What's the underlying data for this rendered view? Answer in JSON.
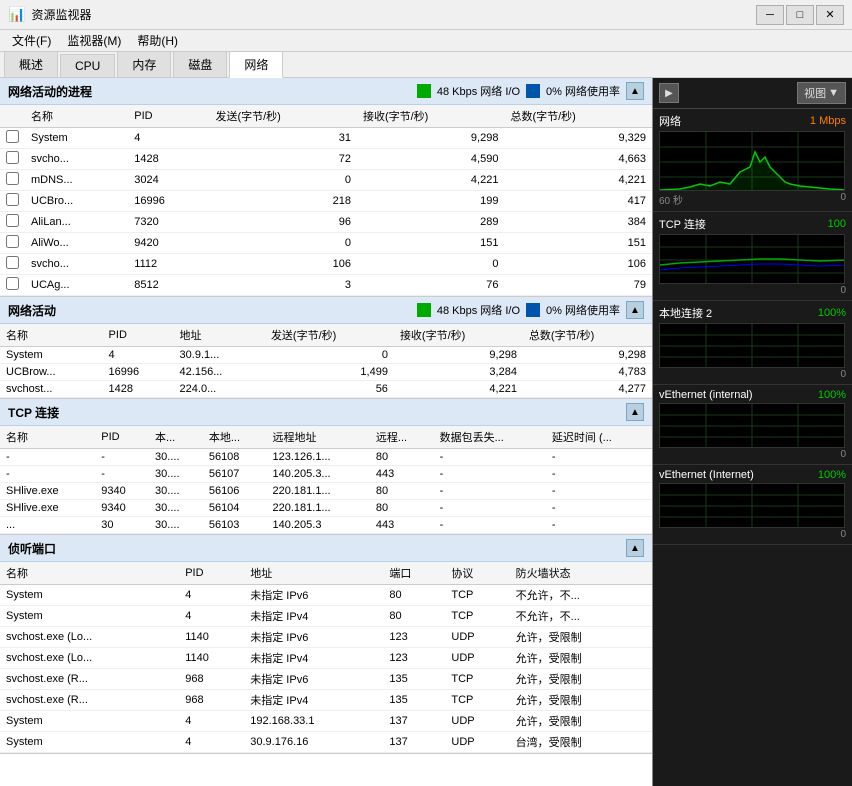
{
  "window": {
    "title": "资源监视器",
    "icon": "📊"
  },
  "titlebar": {
    "minimize": "─",
    "maximize": "□",
    "close": "✕"
  },
  "menubar": {
    "items": [
      "文件(F)",
      "监视器(M)",
      "帮助(H)"
    ]
  },
  "tabs": {
    "items": [
      "概述",
      "CPU",
      "内存",
      "磁盘",
      "网络"
    ],
    "active": "网络"
  },
  "sections": {
    "network_processes": {
      "title": "网络活动的进程",
      "status": "48 Kbps 网络 I/O",
      "status2": "0% 网络使用率",
      "columns": [
        "名称",
        "PID",
        "发送(字节/秒)",
        "接收(字节/秒)",
        "总数(字节/秒)"
      ],
      "rows": [
        {
          "check": false,
          "name": "System",
          "pid": "4",
          "send": "31",
          "recv": "9,298",
          "total": "9,329"
        },
        {
          "check": false,
          "name": "svcho...",
          "pid": "1428",
          "send": "72",
          "recv": "4,590",
          "total": "4,663"
        },
        {
          "check": false,
          "name": "mDNS...",
          "pid": "3024",
          "send": "0",
          "recv": "4,221",
          "total": "4,221"
        },
        {
          "check": false,
          "name": "UCBro...",
          "pid": "16996",
          "send": "218",
          "recv": "199",
          "total": "417"
        },
        {
          "check": false,
          "name": "AliLan...",
          "pid": "7320",
          "send": "96",
          "recv": "289",
          "total": "384"
        },
        {
          "check": false,
          "name": "AliWo...",
          "pid": "9420",
          "send": "0",
          "recv": "151",
          "total": "151"
        },
        {
          "check": false,
          "name": "svcho...",
          "pid": "1112",
          "send": "106",
          "recv": "0",
          "total": "106"
        },
        {
          "check": false,
          "name": "UCAg...",
          "pid": "8512",
          "send": "3",
          "recv": "76",
          "total": "79"
        }
      ]
    },
    "network_activity": {
      "title": "网络活动",
      "indicator_label": "48 Kbps 网络 I/O",
      "indicator_label2": "0% 网络使用率",
      "columns": [
        "名称",
        "PID",
        "地址",
        "发送(字节/秒)",
        "接收(字节/秒)",
        "总数(字节/秒)"
      ],
      "rows": [
        {
          "name": "System",
          "pid": "4",
          "addr": "30.9.1...",
          "send": "0",
          "recv": "9,298",
          "total": "9,298"
        },
        {
          "name": "UCBrow...",
          "pid": "16996",
          "addr": "42.156...",
          "send": "1,499",
          "recv": "3,284",
          "total": "4,783"
        },
        {
          "name": "svchost...",
          "pid": "1428",
          "addr": "224.0...",
          "send": "56",
          "recv": "4,221",
          "total": "4,277"
        }
      ]
    },
    "tcp_connections": {
      "title": "TCP 连接",
      "columns": [
        "名称",
        "PID",
        "本...",
        "本地...",
        "远程地址",
        "远程...",
        "数据包丢失...",
        "延迟时间 (..."
      ],
      "rows": [
        {
          "name": "-",
          "pid": "-",
          "local_ip": "30....",
          "local_port": "56108",
          "remote_addr": "123.126.1...",
          "remote_port": "80",
          "packet_loss": "-",
          "latency": "-"
        },
        {
          "name": "-",
          "pid": "-",
          "local_ip": "30....",
          "local_port": "56107",
          "remote_addr": "140.205.3...",
          "remote_port": "443",
          "packet_loss": "-",
          "latency": "-"
        },
        {
          "name": "SHlive.exe",
          "pid": "9340",
          "local_ip": "30....",
          "local_port": "56106",
          "remote_addr": "220.181.1...",
          "remote_port": "80",
          "packet_loss": "-",
          "latency": "-"
        },
        {
          "name": "SHlive.exe",
          "pid": "9340",
          "local_ip": "30....",
          "local_port": "56104",
          "remote_addr": "220.181.1...",
          "remote_port": "80",
          "packet_loss": "-",
          "latency": "-"
        },
        {
          "name": "...",
          "pid": "30",
          "local_ip": "30....",
          "local_port": "56103",
          "remote_addr": "140.205.3",
          "remote_port": "443",
          "packet_loss": "-",
          "latency": "-"
        }
      ]
    },
    "listening_ports": {
      "title": "侦听端口",
      "columns": [
        "名称",
        "PID",
        "地址",
        "端口",
        "协议",
        "防火墙状态"
      ],
      "rows": [
        {
          "name": "System",
          "pid": "4",
          "addr": "未指定 IPv6",
          "port": "80",
          "protocol": "TCP",
          "firewall": "不允许，不..."
        },
        {
          "name": "System",
          "pid": "4",
          "addr": "未指定 IPv4",
          "port": "80",
          "protocol": "TCP",
          "firewall": "不允许，不..."
        },
        {
          "name": "svchost.exe (Lo...",
          "pid": "1140",
          "addr": "未指定 IPv6",
          "port": "123",
          "protocol": "UDP",
          "firewall": "允许，受限制"
        },
        {
          "name": "svchost.exe (Lo...",
          "pid": "1140",
          "addr": "未指定 IPv4",
          "port": "123",
          "protocol": "UDP",
          "firewall": "允许，受限制"
        },
        {
          "name": "svchost.exe (R...",
          "pid": "968",
          "addr": "未指定 IPv6",
          "port": "135",
          "protocol": "TCP",
          "firewall": "允许，受限制"
        },
        {
          "name": "svchost.exe (R...",
          "pid": "968",
          "addr": "未指定 IPv4",
          "port": "135",
          "protocol": "TCP",
          "firewall": "允许，受限制"
        },
        {
          "name": "System",
          "pid": "4",
          "addr": "192.168.33.1",
          "port": "137",
          "protocol": "UDP",
          "firewall": "允许，受限制"
        },
        {
          "name": "System",
          "pid": "4",
          "addr": "30.9.176.16",
          "port": "137",
          "protocol": "UDP",
          "firewall": "台湾，受限制"
        }
      ]
    }
  },
  "right_panel": {
    "view_btn": "视图",
    "graphs": [
      {
        "title": "网络",
        "value": "1 Mbps",
        "footer_left": "60 秒",
        "footer_right": "0",
        "type": "network"
      },
      {
        "title": "TCP 连接",
        "value": "100",
        "type": "tcp"
      },
      {
        "title": "本地连接 2",
        "value": "100%",
        "type": "small"
      },
      {
        "title": "vEthernet (internal)",
        "value": "100%",
        "type": "small"
      },
      {
        "title": "vEthernet (Internet)",
        "value": "100%",
        "type": "small"
      }
    ]
  }
}
